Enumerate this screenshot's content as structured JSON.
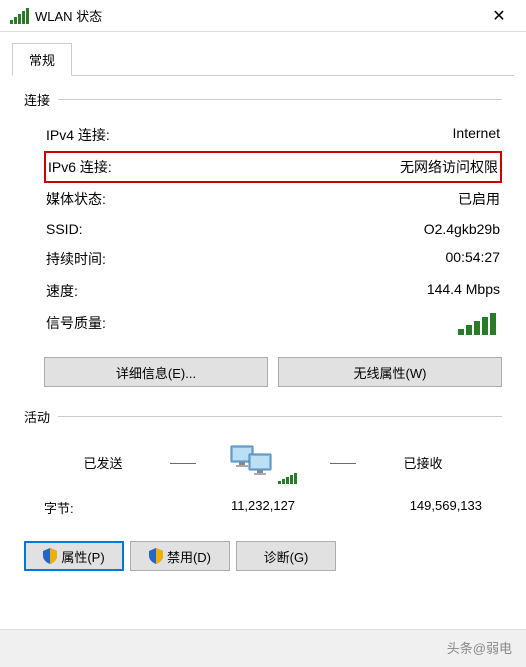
{
  "title": "WLAN 状态",
  "tab": "常规",
  "section_connection": "连接",
  "section_activity": "活动",
  "rows": {
    "ipv4_label": "IPv4 连接:",
    "ipv4_value": "Internet",
    "ipv6_label": "IPv6 连接:",
    "ipv6_value": "无网络访问权限",
    "media_label": "媒体状态:",
    "media_value": "已启用",
    "ssid_label": "SSID:",
    "ssid_value": "O2.4gkb29b",
    "duration_label": "持续时间:",
    "duration_value": "00:54:27",
    "speed_label": "速度:",
    "speed_value": "144.4 Mbps",
    "signal_label": "信号质量:"
  },
  "buttons": {
    "details": "详细信息(E)...",
    "wireless": "无线属性(W)",
    "properties": "属性(P)",
    "disable": "禁用(D)",
    "diagnose": "诊断(G)"
  },
  "activity": {
    "sent_label": "已发送",
    "received_label": "已接收",
    "bytes_label": "字节:",
    "bytes_sent": "11,232,127",
    "bytes_received": "149,569,133"
  },
  "footer": "头条@弱电"
}
